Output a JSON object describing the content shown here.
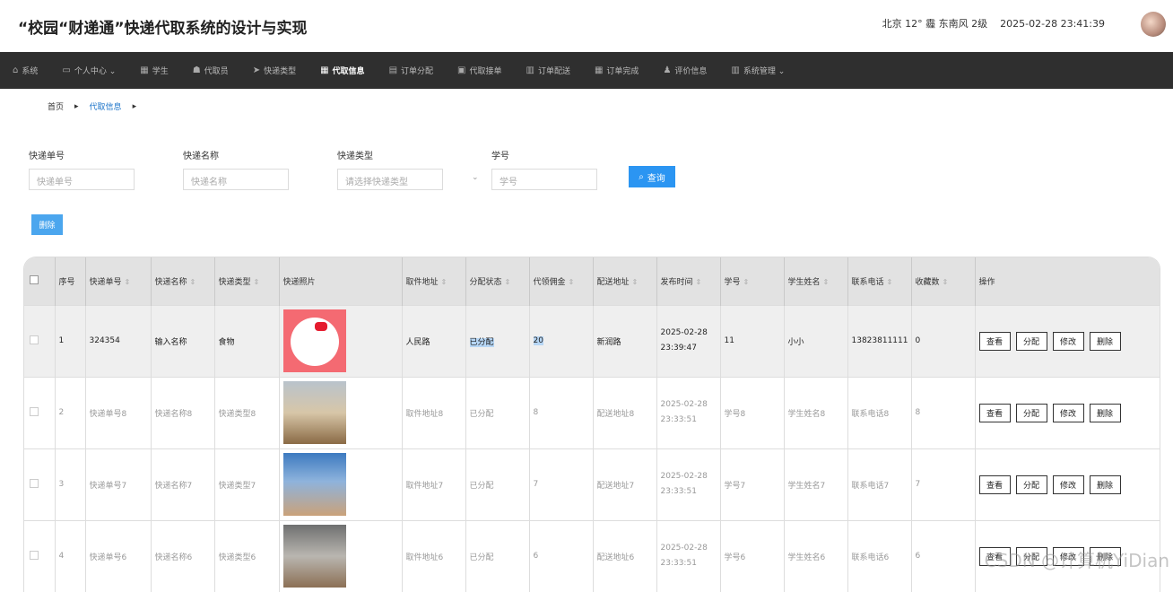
{
  "app": {
    "title": "“校园“财递通”快递代取系统的设计与实现"
  },
  "topinfo": {
    "city": "北京",
    "temp": "12°",
    "weather_icon": "霾",
    "wind": "东南风 2级",
    "datetime": "2025-02-28 23:41:39"
  },
  "nav": [
    {
      "icon": "⌂",
      "label": "系统"
    },
    {
      "icon": "▭",
      "label": "个人中心 ⌄"
    },
    {
      "icon": "▦",
      "label": "学生"
    },
    {
      "icon": "☗",
      "label": "代取员"
    },
    {
      "icon": "➤",
      "label": "快递类型"
    },
    {
      "icon": "▦",
      "label": "代取信息"
    },
    {
      "icon": "▤",
      "label": "订单分配"
    },
    {
      "icon": "▣",
      "label": "代取接单"
    },
    {
      "icon": "▥",
      "label": "订单配送"
    },
    {
      "icon": "▦",
      "label": "订单完成"
    },
    {
      "icon": "♟",
      "label": "评价信息"
    },
    {
      "icon": "▥",
      "label": "系统管理 ⌄"
    }
  ],
  "breadcrumb": {
    "home": "首页",
    "current": "代取信息"
  },
  "filters": {
    "express_no": {
      "label": "快递单号",
      "placeholder": "快递单号"
    },
    "express_name": {
      "label": "快递名称",
      "placeholder": "快递名称"
    },
    "express_type": {
      "label": "快递类型",
      "placeholder": "请选择快递类型"
    },
    "student_no": {
      "label": "学号",
      "placeholder": "学号"
    },
    "search_label": "查询"
  },
  "actions": {
    "delete_label": "删除"
  },
  "table": {
    "headers": [
      "序号",
      "快递单号",
      "快递名称",
      "快递类型",
      "快递照片",
      "取件地址",
      "分配状态",
      "代领佣金",
      "配送地址",
      "发布时间",
      "学号",
      "学生姓名",
      "联系电话",
      "收藏数",
      "操作"
    ],
    "rows": [
      {
        "no": "1",
        "express_no": "324354",
        "name": "输入名称",
        "type": "食物",
        "addr": "人民路",
        "status": "已分配",
        "fee": "20",
        "dest": "新润路",
        "time": "2025-02-28 23:39:47",
        "sid": "11",
        "sname": "小小",
        "phone": "13823811111",
        "fav": "0"
      },
      {
        "no": "2",
        "express_no": "快递单号8",
        "name": "快递名称8",
        "type": "快递类型8",
        "addr": "取件地址8",
        "status": "已分配",
        "fee": "8",
        "dest": "配送地址8",
        "time": "2025-02-28 23:33:51",
        "sid": "学号8",
        "sname": "学生姓名8",
        "phone": "联系电话8",
        "fav": "8"
      },
      {
        "no": "3",
        "express_no": "快递单号7",
        "name": "快递名称7",
        "type": "快递类型7",
        "addr": "取件地址7",
        "status": "已分配",
        "fee": "7",
        "dest": "配送地址7",
        "time": "2025-02-28 23:33:51",
        "sid": "学号7",
        "sname": "学生姓名7",
        "phone": "联系电话7",
        "fav": "7"
      },
      {
        "no": "4",
        "express_no": "快递单号6",
        "name": "快递名称6",
        "type": "快递类型6",
        "addr": "取件地址6",
        "status": "已分配",
        "fee": "6",
        "dest": "配送地址6",
        "time": "2025-02-28 23:33:51",
        "sid": "学号6",
        "sname": "学生姓名6",
        "phone": "联系电话6",
        "fav": "6"
      }
    ],
    "ops": [
      "查看",
      "分配",
      "修改",
      "删除"
    ]
  },
  "watermark": "CSDN @计算机YiDian"
}
